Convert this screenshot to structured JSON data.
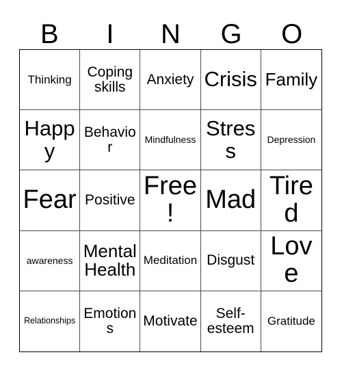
{
  "card": {
    "title": "BINGO",
    "header_letters": [
      "B",
      "I",
      "N",
      "G",
      "O"
    ],
    "colors": {
      "background": "#ffffff",
      "text": "#000000",
      "grid_line": "#4a4a4a",
      "outer_border": "#000000"
    },
    "grid_size": "5x5",
    "free_space": "Free!",
    "cells": [
      {
        "text": "Thinking",
        "size": "sm"
      },
      {
        "text": "Coping skills",
        "size": "md"
      },
      {
        "text": "Anxiety",
        "size": "md"
      },
      {
        "text": "Crisis",
        "size": "xl"
      },
      {
        "text": "Family",
        "size": "lg"
      },
      {
        "text": "Happy",
        "size": "xl"
      },
      {
        "text": "Behavior",
        "size": "md"
      },
      {
        "text": "Mindfulness",
        "size": "xs"
      },
      {
        "text": "Stress",
        "size": "xl"
      },
      {
        "text": "Depression",
        "size": "xs"
      },
      {
        "text": "Fear",
        "size": "xxl"
      },
      {
        "text": "Positive",
        "size": "md"
      },
      {
        "text": "Free!",
        "size": "xxl"
      },
      {
        "text": "Mad",
        "size": "xxl"
      },
      {
        "text": "Tired",
        "size": "xxl"
      },
      {
        "text": "awareness",
        "size": "xs"
      },
      {
        "text": "Mental Health",
        "size": "lg"
      },
      {
        "text": "Meditation",
        "size": "sm"
      },
      {
        "text": "Disgust",
        "size": "md"
      },
      {
        "text": "Love",
        "size": "xxl"
      },
      {
        "text": "Relationships",
        "size": "xxs"
      },
      {
        "text": "Emotions",
        "size": "md"
      },
      {
        "text": "Motivate",
        "size": "md"
      },
      {
        "text": "Self-esteem",
        "size": "md"
      },
      {
        "text": "Gratitude",
        "size": "sm"
      }
    ]
  }
}
